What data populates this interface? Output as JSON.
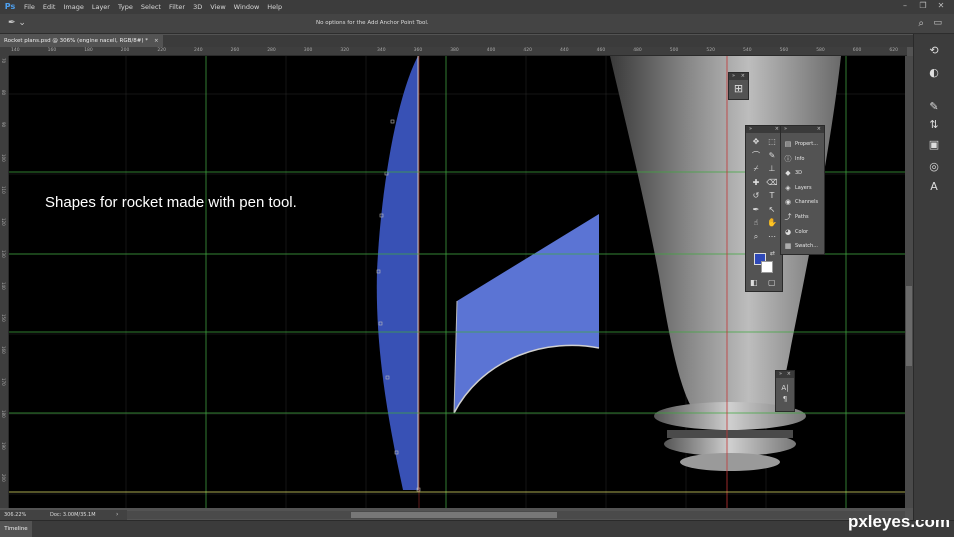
{
  "app": {
    "logo": "Ps"
  },
  "menu": [
    "File",
    "Edit",
    "Image",
    "Layer",
    "Type",
    "Select",
    "Filter",
    "3D",
    "View",
    "Window",
    "Help"
  ],
  "window_controls": [
    "–",
    "❐",
    "✕"
  ],
  "options_bar": {
    "tool_icon": "add-anchor-pen-icon",
    "tool_glyph": "✒",
    "dropdown_glyph": "⌄",
    "message": "No options for the Add Anchor Point Tool.",
    "search_glyph": "⌕",
    "workspace_glyph": "▭"
  },
  "document_tab": {
    "title": "Rocket plans.psd @ 306% (engine nacell, RGB/8#) *",
    "close": "×"
  },
  "ruler": {
    "h_labels": [
      "140",
      "160",
      "180",
      "200",
      "220",
      "240",
      "260",
      "280",
      "300",
      "320",
      "340",
      "360",
      "380",
      "400",
      "420",
      "440",
      "460",
      "480",
      "500",
      "520",
      "540",
      "560",
      "580",
      "600",
      "620"
    ],
    "v_labels": [
      "70",
      "80",
      "90",
      "100",
      "110",
      "120",
      "130",
      "140",
      "150",
      "160",
      "170",
      "180",
      "190",
      "200"
    ]
  },
  "canvas": {
    "caption": "Shapes for rocket made with pen tool.",
    "colors": {
      "blue_shape": "#3851b5",
      "light_blue_shape": "#5b74d4",
      "guide_green": "#3fa83f",
      "guide_red": "#c23535",
      "baseline_yellow": "#e3e36a",
      "engine_gray": "#8c8c8c"
    }
  },
  "status": {
    "zoom": "306.22%",
    "doc": "Doc: 3.00M/35.1M",
    "arrow": "›"
  },
  "timeline": {
    "tab": "Timeline"
  },
  "watermark": "pxleyes.com",
  "right_strip": [
    {
      "name": "history-icon",
      "glyph": "⟲"
    },
    {
      "name": "color-wheel-icon",
      "glyph": "◐"
    },
    {
      "name": "brush-icon",
      "glyph": "✎"
    },
    {
      "name": "adjust-icon",
      "glyph": "⇅"
    },
    {
      "name": "clone-icon",
      "glyph": "▣"
    },
    {
      "name": "swirl-icon",
      "glyph": "◎"
    },
    {
      "name": "type-glyph-icon",
      "glyph": "A"
    }
  ],
  "toolbox": {
    "tools": [
      {
        "name": "move-tool-icon",
        "glyph": "✥"
      },
      {
        "name": "marquee-tool-icon",
        "glyph": "⬚"
      },
      {
        "name": "lasso-tool-icon",
        "glyph": "⌒"
      },
      {
        "name": "brush-tool-icon",
        "glyph": "✎"
      },
      {
        "name": "eyedropper-tool-icon",
        "glyph": "⌿"
      },
      {
        "name": "stamp-tool-icon",
        "glyph": "⊥"
      },
      {
        "name": "healing-tool-icon",
        "glyph": "✚"
      },
      {
        "name": "eraser-tool-icon",
        "glyph": "⌫"
      },
      {
        "name": "history-brush-tool-icon",
        "glyph": "↺"
      },
      {
        "name": "type-tool-icon",
        "glyph": "T"
      },
      {
        "name": "pen-tool-icon",
        "glyph": "✒"
      },
      {
        "name": "path-select-tool-icon",
        "glyph": "↖"
      },
      {
        "name": "smudge-tool-icon",
        "glyph": "☝"
      },
      {
        "name": "hand-tool-icon",
        "glyph": "✋"
      },
      {
        "name": "zoom-tool-icon",
        "glyph": "⌕"
      },
      {
        "name": "more-tools-icon",
        "glyph": "⋯"
      }
    ],
    "fg_color": "#2f49b8",
    "bg_color": "#ffffff",
    "swap_glyph": "⇄",
    "mask_glyph": "◧",
    "screen_glyph": "▢"
  },
  "dock_panels": [
    {
      "name": "properties-panel-item",
      "icon": "▤",
      "label": "Propert..."
    },
    {
      "name": "info-panel-item",
      "icon": "ⓘ",
      "label": "Info"
    },
    {
      "name": "3d-panel-item",
      "icon": "◆",
      "label": "3D"
    },
    {
      "name": "layers-panel-item",
      "icon": "◈",
      "label": "Layers"
    },
    {
      "name": "channels-panel-item",
      "icon": "◉",
      "label": "Channels"
    },
    {
      "name": "paths-panel-item",
      "icon": "⤴",
      "label": "Paths"
    },
    {
      "name": "color-panel-item",
      "icon": "◕",
      "label": "Color"
    },
    {
      "name": "swatches-panel-item",
      "icon": "▦",
      "label": "Swatch..."
    }
  ],
  "panel_head": {
    "grip": "»",
    "close": "×"
  },
  "nav_panel": {
    "icon": "⊞"
  },
  "char_panel": {
    "glyph1": "A|",
    "glyph2": "¶"
  }
}
